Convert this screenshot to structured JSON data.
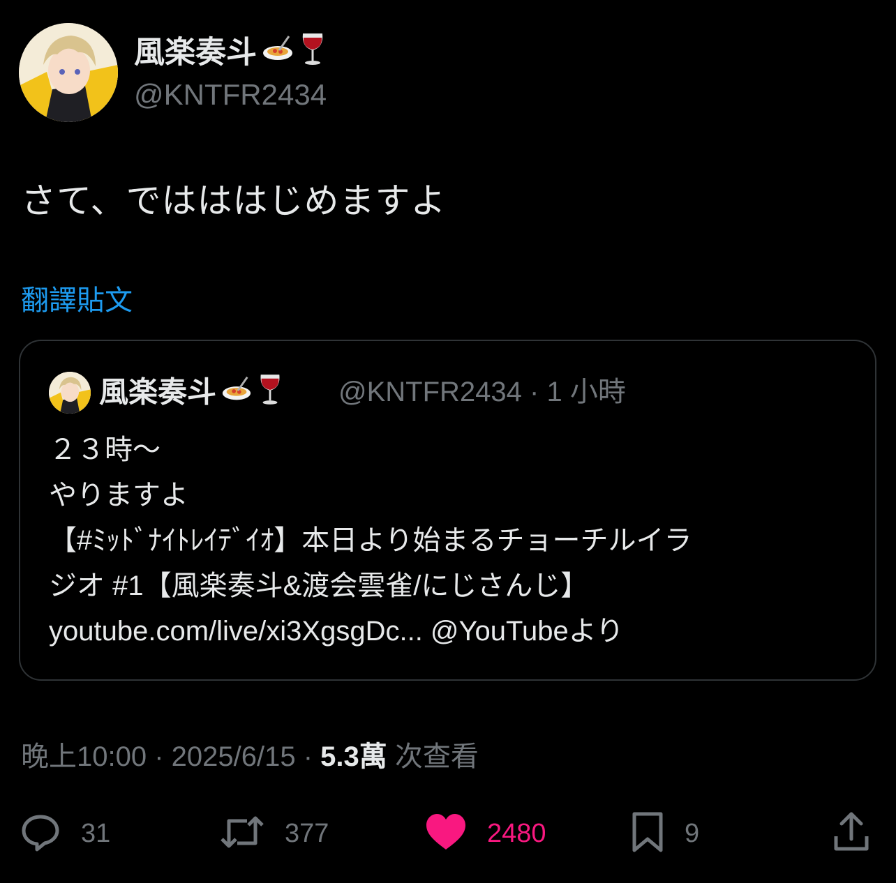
{
  "author": {
    "display_name": "風楽奏斗",
    "handle": "@KNTFR2434",
    "name_emojis": [
      "spaghetti-emoji",
      "wine-glass-emoji"
    ]
  },
  "tweet": {
    "text": "さて、ではははじめますよ",
    "translate_label": "翻譯貼文"
  },
  "quote": {
    "display_name": "風楽奏斗",
    "meta": "@KNTFR2434 · 1 小時",
    "lines": [
      "２３時～",
      "やりますよ",
      "【#ﾐｯﾄﾞﾅｲﾄﾚｲﾃﾞｲｵ】本日より始まるチョーチルイラ",
      "ジオ #1【風楽奏斗&渡会雲雀/にじさんじ】",
      "youtube.com/live/xi3XgsgDc... @YouTubeより"
    ]
  },
  "meta": {
    "time": "晚上10:00 · 2025/6/15 · ",
    "views_count": "5.3萬",
    "views_label": " 次查看"
  },
  "actions": {
    "replies": "31",
    "reposts": "377",
    "likes": "2480",
    "bookmarks": "9"
  },
  "colors": {
    "background": "#000000",
    "text": "#e7e9ea",
    "secondary": "#71767b",
    "link": "#1d9bf0",
    "like": "#f91880",
    "border": "#2f3336"
  }
}
